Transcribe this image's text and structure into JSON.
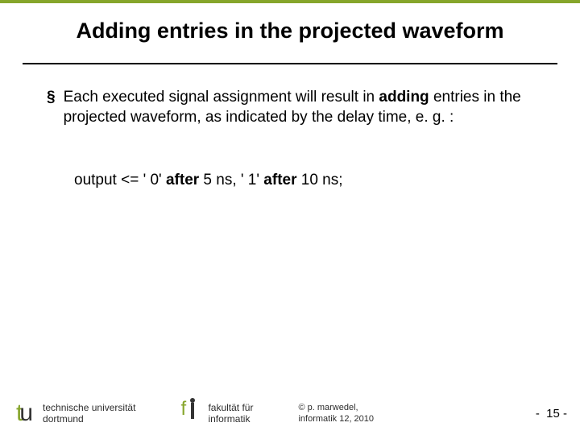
{
  "title": "Adding entries in the projected waveform",
  "bullet": {
    "pre": "Each executed signal assignment will result in ",
    "strong1": "adding",
    "post": " entries in the projected waveform, as indicated by the delay time, e. g. :"
  },
  "code": {
    "p1": "output <= ' 0' ",
    "b1": "after",
    "p2": " 5 ns, ' 1' ",
    "b2": "after",
    "p3": " 10 ns;"
  },
  "footer": {
    "uni_line1": "technische universität",
    "uni_line2": "dortmund",
    "fi_line1": "fakultät für",
    "fi_line2": "informatik",
    "copy_line1": "©  p. marwedel,",
    "copy_line2": "informatik 12,  2010",
    "page": "-  15 -"
  }
}
